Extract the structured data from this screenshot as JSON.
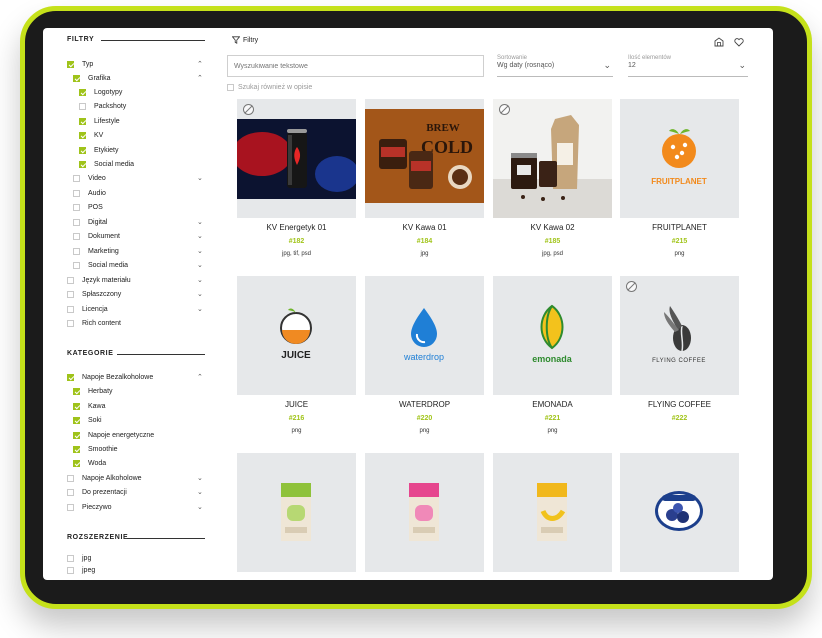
{
  "sidebar": {
    "filters_heading": "FILTRY",
    "typ": {
      "label": "Typ",
      "grafika": {
        "label": "Grafika",
        "items": [
          "Logotypy",
          "Packshoty",
          "Lifestyle",
          "KV",
          "Etykiety",
          "Social media"
        ]
      },
      "other_items": [
        "Video",
        "Audio",
        "POS",
        "Digital",
        "Dokument",
        "Marketing",
        "Social media"
      ]
    },
    "extra_filters": [
      "Język materiału",
      "Spłaszczony",
      "Licencja",
      "Rich content"
    ],
    "categories_heading": "KATEGORIE",
    "napoje_bezalkoholowe": {
      "label": "Napoje Bezalkoholowe",
      "items": [
        "Herbaty",
        "Kawa",
        "Soki",
        "Napoje energetyczne",
        "Smoothie",
        "Woda"
      ]
    },
    "other_categories": [
      "Napoje Alkoholowe",
      "Do prezentacji",
      "Pieczywo"
    ],
    "extension_heading": "ROZSZERZENIE",
    "extensions": [
      "jpg",
      "jpeg"
    ]
  },
  "toolbar": {
    "filters_label": "Filtry",
    "search_placeholder": "Wyszukiwanie tekstowe",
    "sort_label": "Sortowanie",
    "sort_value": "Wg daty (rosnąco)",
    "count_label": "Ilość elementów",
    "count_value": "12",
    "description_label": "Szukaj również w opisie"
  },
  "cards": [
    {
      "name": "KV Energetyk 01",
      "id": "#182",
      "formats": "jpg, tif, psd",
      "thumb": "energy-can"
    },
    {
      "name": "KV Kawa 01",
      "id": "#184",
      "formats": "jpg",
      "thumb": "brew-cold"
    },
    {
      "name": "KV Kawa 02",
      "id": "#185",
      "formats": "jpg, psd",
      "thumb": "coffee-jars"
    },
    {
      "name": "FRUITPLANET",
      "id": "#215",
      "formats": "png",
      "thumb": "fruitplanet-logo",
      "logo_text": "FRUITPLANET"
    },
    {
      "name": "JUICE",
      "id": "#216",
      "formats": "png",
      "thumb": "juice-logo",
      "logo_text": "JUICE"
    },
    {
      "name": "WATERDROP",
      "id": "#220",
      "formats": "png",
      "thumb": "waterdrop-logo",
      "logo_text": "waterdrop"
    },
    {
      "name": "EMONADA",
      "id": "#221",
      "formats": "png",
      "thumb": "emonada-logo",
      "logo_text": "emonada"
    },
    {
      "name": "FLYING COFFEE",
      "id": "#222",
      "formats": "",
      "thumb": "flying-coffee-logo",
      "logo_text": "FLYING COFFEE"
    },
    {
      "name": "",
      "id": "",
      "formats": "",
      "thumb": "fresh-fruits-green"
    },
    {
      "name": "",
      "id": "",
      "formats": "",
      "thumb": "fresh-fruits-pink"
    },
    {
      "name": "",
      "id": "",
      "formats": "",
      "thumb": "fresh-fruits-yellow"
    },
    {
      "name": "",
      "id": "",
      "formats": "",
      "thumb": "blueberry-label"
    }
  ],
  "colors": {
    "accent": "#a2c51c",
    "bezel_border": "#c5e11a",
    "thumb_bg": "#e6e8ea"
  }
}
